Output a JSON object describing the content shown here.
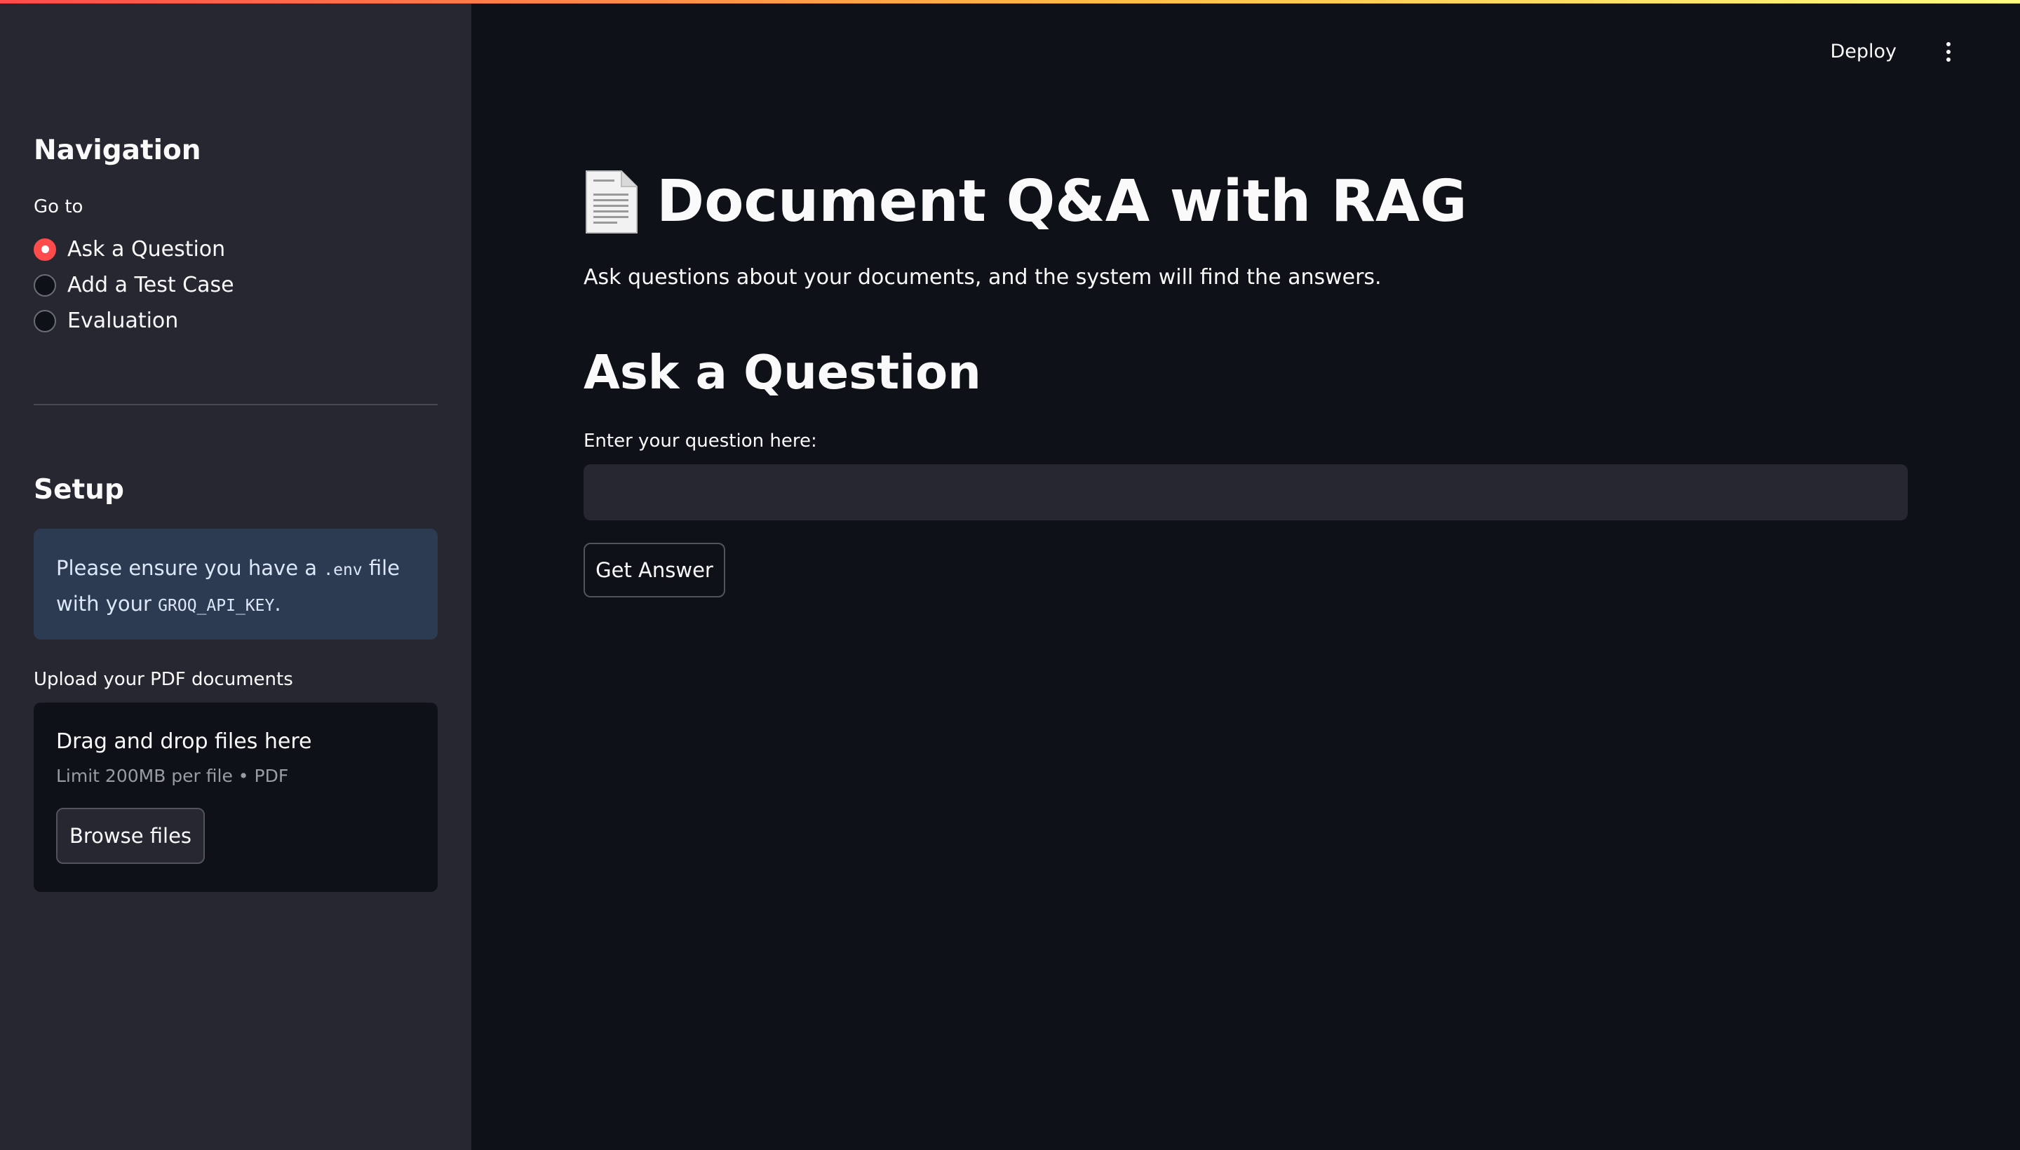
{
  "header": {
    "deploy_label": "Deploy",
    "menu_icon": "kebab-menu-icon"
  },
  "sidebar": {
    "nav_title": "Navigation",
    "goto_label": "Go to",
    "radio_options": [
      {
        "label": "Ask a Question",
        "selected": true
      },
      {
        "label": "Add a Test Case",
        "selected": false
      },
      {
        "label": "Evaluation",
        "selected": false
      }
    ],
    "setup_title": "Setup",
    "info": {
      "text_1": "Please ensure you have a ",
      "code_1": ".env",
      "text_2": " file with your ",
      "code_2": "GROQ_API_KEY",
      "text_3": "."
    },
    "upload_label": "Upload your PDF documents",
    "dropzone": {
      "title": "Drag and drop files here",
      "subtitle": "Limit 200MB per file • PDF",
      "browse_label": "Browse files"
    }
  },
  "main": {
    "title_icon": "document-icon",
    "title": "Document Q&A with RAG",
    "subtitle": "Ask questions about your documents, and the system will find the answers.",
    "section_title": "Ask a Question",
    "question_label": "Enter your question here:",
    "question_value": "",
    "submit_label": "Get Answer"
  },
  "colors": {
    "accent": "#ff4b4b",
    "sidebar_bg": "#262730",
    "main_bg": "#0e1117",
    "info_bg": "#2c3a52"
  }
}
